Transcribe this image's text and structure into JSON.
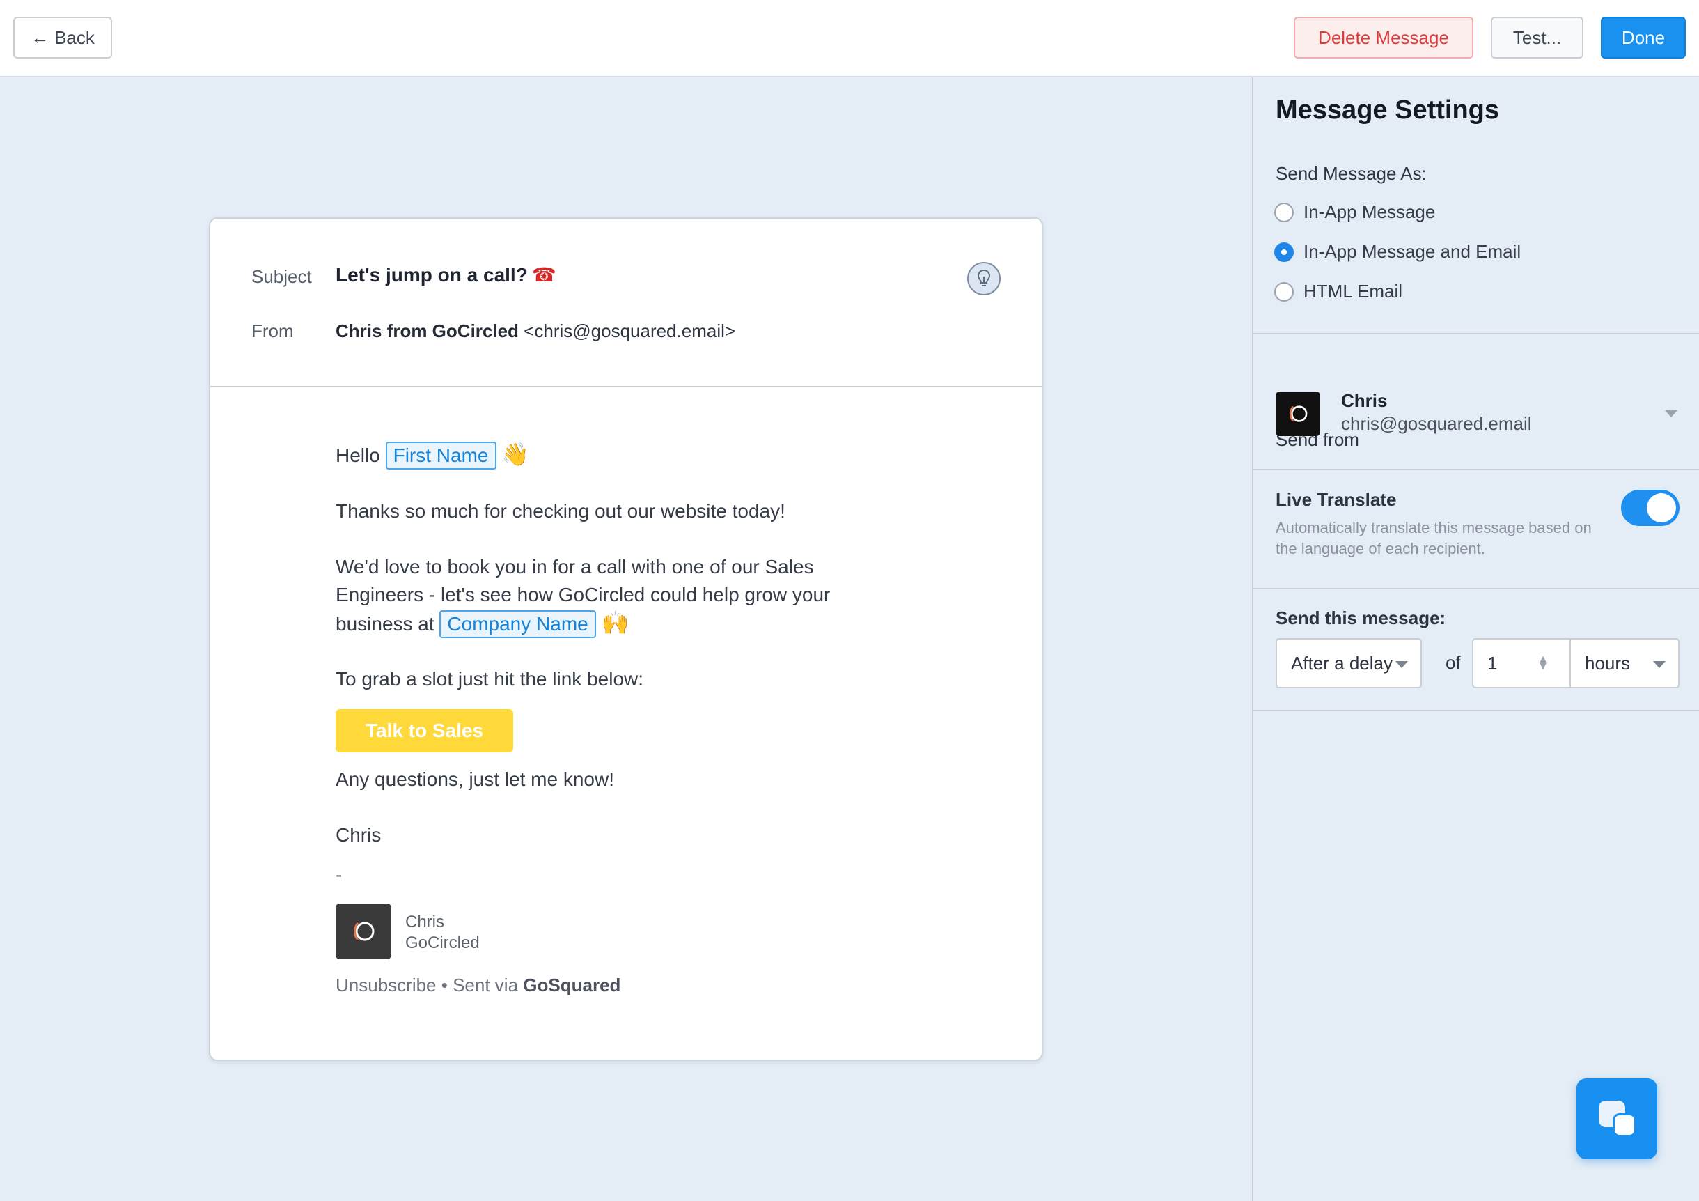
{
  "toolbar": {
    "back_label": "Back",
    "delete_label": "Delete Message",
    "test_label": "Test...",
    "done_label": "Done"
  },
  "email": {
    "subject_label": "Subject",
    "subject": "Let's jump on a call?",
    "subject_emoji": "☎",
    "from_label": "From",
    "from_name": "Chris from GoCircled",
    "from_address": "<chris@gosquared.email>",
    "greeting": "Hello",
    "first_name_tag": "First Name",
    "wave_emoji": "👋",
    "para1": "Thanks so much for checking out our website today!",
    "para2_line1": "We'd love to book you in for a call with one of our Sales",
    "para2_line2": "Engineers - let's see how GoCircled could help grow your",
    "para2_line3": "business at",
    "company_tag": "Company Name",
    "hands_emoji": "🙌",
    "para3": "To grab a slot just hit the link below:",
    "cta_label": "Talk to Sales",
    "para4": "Any questions, just let me know!",
    "signoff": "Chris",
    "dash": "-",
    "sig_name": "Chris",
    "sig_company": "GoCircled",
    "unsubscribe": "Unsubscribe",
    "bullet": "•",
    "sent_via": "Sent via",
    "brand": "GoSquared"
  },
  "settings": {
    "title": "Message Settings",
    "send_as_label": "Send Message As:",
    "send_as_options": [
      {
        "label": "In-App Message",
        "selected": false
      },
      {
        "label": "In-App Message and Email",
        "selected": true
      },
      {
        "label": "HTML Email",
        "selected": false
      }
    ],
    "send_from_label": "Send from",
    "sender_name": "Chris",
    "sender_email": "chris@gosquared.email",
    "live_translate_title": "Live Translate",
    "live_translate_desc": "Automatically translate this message based on the language of each recipient.",
    "live_translate_on": true,
    "send_this_label": "Send this message:",
    "timing_select": "After a delay",
    "of_label": "of",
    "delay_value": "1",
    "delay_unit": "hours"
  },
  "colors": {
    "accent": "#1891f0",
    "danger": "#de3c3c",
    "cta": "#ffd83a",
    "background": "#e4edf5"
  }
}
